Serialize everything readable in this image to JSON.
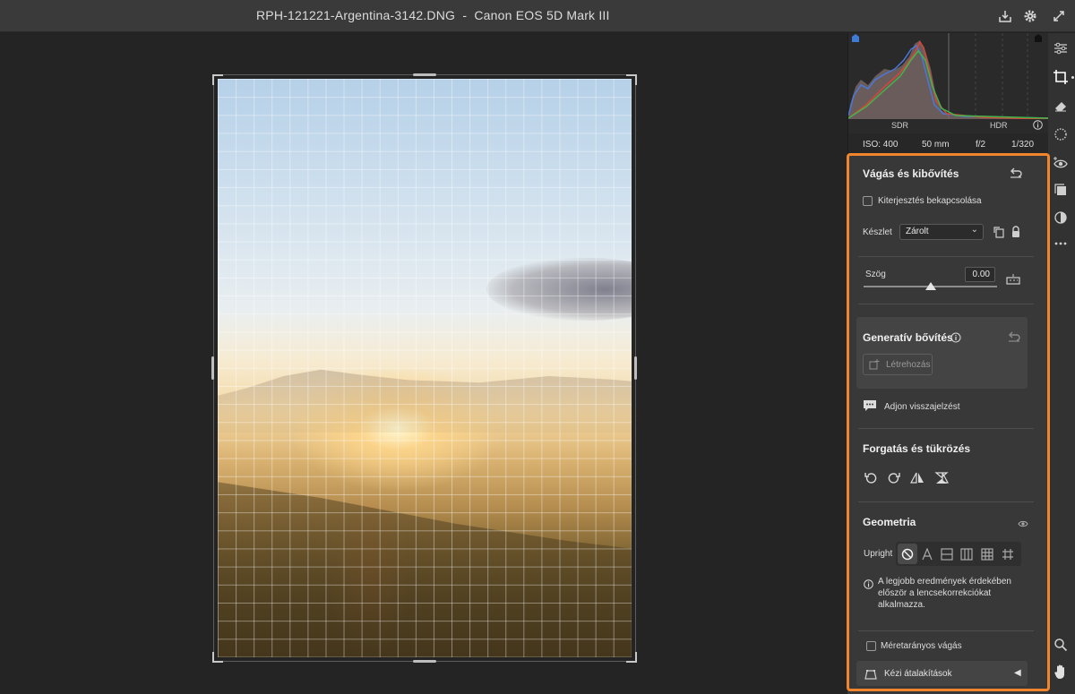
{
  "window": {
    "title": "RPH-121221-Argentina-3142.DNG  -  Canon EOS 5D Mark III"
  },
  "histogram": {
    "sdr_label": "SDR",
    "hdr_label": "HDR"
  },
  "exif": {
    "iso": "ISO: 400",
    "focal": "50 mm",
    "aperture": "f/2",
    "shutter": "1/320"
  },
  "crop": {
    "title": "Vágás és kibővítés",
    "extend_label": "Kiterjesztés bekapcsolása",
    "extend_checked": false,
    "preset_label": "Készlet",
    "preset_value": "Zárolt",
    "angle_label": "Szög",
    "angle_value": "0.00",
    "angle_level": 0.5
  },
  "generative": {
    "title": "Generatív bővítés",
    "create_label": "Létrehozás"
  },
  "feedback": {
    "label": "Adjon visszajelzést"
  },
  "rotate": {
    "title": "Forgatás és tükrözés"
  },
  "geometry": {
    "title": "Geometria",
    "upright_label": "Upright",
    "info_line1": "A legjobb eredmények érdekében",
    "info_line2": "először a lencsekorrekciókat",
    "info_line3": "alkalmazza.",
    "proportional_label": "Méretarányos vágás",
    "proportional_checked": false,
    "manual_label": "Kézi átalakítások"
  },
  "colors": {
    "highlight": "#f0852d",
    "panel": "#383838",
    "titlebar": "#3a3a3a"
  },
  "icons": {
    "titlebar": [
      "save-icon",
      "settings-gear-icon",
      "fullscreen-icon"
    ],
    "toolstrip": [
      "edit-sliders-icon",
      "crop-icon",
      "eraser-icon",
      "masking-icon",
      "red-eye-icon",
      "presets-icon",
      "remove-icon",
      "more-icon",
      "zoom-icon",
      "hand-icon"
    ]
  }
}
